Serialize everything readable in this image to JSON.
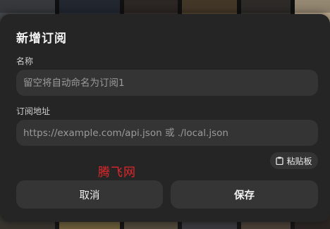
{
  "dialog": {
    "title": "新增订阅",
    "name_label": "名称",
    "name_placeholder": "留空将自动命名为订阅1",
    "name_value": "",
    "url_label": "订阅地址",
    "url_placeholder": "https://example.com/api.json 或 ./local.json",
    "url_value": "",
    "paste_label": "粘贴板",
    "cancel_label": "取消",
    "save_label": "保存"
  },
  "watermark": "腾飞网",
  "icons": {
    "paste": "clipboard-icon"
  },
  "colors": {
    "dialog_bg": "#252525",
    "field_bg": "#343434",
    "button_bg": "#353535",
    "watermark": "#e0262b"
  }
}
